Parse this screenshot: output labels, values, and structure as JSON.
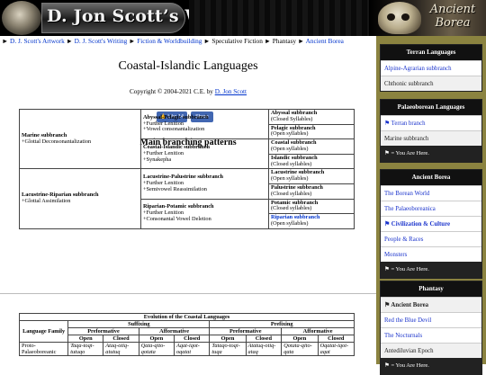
{
  "banner": {
    "title": "D. Jon Scott’s Website",
    "right_line1": "Ancient",
    "right_line2": "Borea"
  },
  "breadcrumb": [
    {
      "text": "D. J. Scott's Artwork",
      "link": true
    },
    {
      "text": "D. J. Scott's Writing",
      "link": true
    },
    {
      "text": "Fiction & Worldbuilding",
      "link": true
    },
    {
      "text": "Speculative Fiction",
      "link": false
    },
    {
      "text": "Phantasy",
      "link": false
    },
    {
      "text": "Ancient Borea",
      "link": true
    }
  ],
  "page": {
    "title": "Coastal-Islandic Languages",
    "copyright_prefix": "Copyright © 2004-2021 C.E. by ",
    "copyright_author": "D. Jon Scott",
    "fb_label": "Like 14",
    "share_label": "Share",
    "section_heading": "Main branching patterns"
  },
  "branching": {
    "marine": {
      "name": "Marine subbranch",
      "desc": "+Glottal Deconsonantalization"
    },
    "lacustrine_riparian": {
      "name": "Lacustrine-Riparian subbranch",
      "desc": "+Glottal Assimilation"
    },
    "abyssal_pelagic": {
      "name": "Abyssal-Pelagic subbranch",
      "d1": "+Further Lenition",
      "d2": "+Vowel consonantalization"
    },
    "coastal_islandic": {
      "name": "Coastal-Islandic subbranch",
      "d1": "+Further Lenition",
      "d2": "+Synakepha"
    },
    "lacustrine_palustrine": {
      "name": "Lacustrine-Palustrine subbranch",
      "d1": "+Further Lenition",
      "d2": "+Semivowel Reassimilation"
    },
    "riparian_potamic": {
      "name": "Riparian-Potamic subbranch",
      "d1": "+Further Lenition",
      "d2": "+Consonantal Vowel Deletion"
    },
    "leaves": [
      {
        "name": "Abyssal subbranch",
        "desc": "(Closed Syllables)"
      },
      {
        "name": "Pelagic subbranch",
        "desc": "(Open syllables)"
      },
      {
        "name": "Coastal subbranch",
        "desc": "(Open syllables)"
      },
      {
        "name": "Islandic subbranch",
        "desc": "(Closed syllables)"
      },
      {
        "name": "Lacustrine subbranch",
        "desc": "(Open syllables)"
      },
      {
        "name": "Palustrine subbranch",
        "desc": "(Closed syllables)"
      },
      {
        "name": "Potamic subbranch",
        "desc": "(Closed syllables)"
      },
      {
        "name": "Riparian subbranch",
        "desc": "(Open syllables)"
      }
    ]
  },
  "evolution": {
    "caption": "Evolution of the Coastal Languages",
    "suffixing": "Suffixing",
    "prefixing": "Prefixing",
    "language_family": "Language Family",
    "preformative": "Preformative",
    "afformative": "Afformative",
    "open": "Open",
    "closed": "Closed",
    "row1": {
      "family": "Proto-Palaeoboreanic",
      "cells": [
        "Taqa-toqi-tutuqo",
        "Ataq-otiq-atutuq",
        "Qata-qito-qotata",
        "Aqat-iqot-oqatat",
        "Tataqo-toqi-tuqa",
        "Atatuq-otiq-ataq",
        "Qotata-qito-qata",
        "Oqatat-iqot-aqat"
      ]
    }
  },
  "sidebar": {
    "terran": {
      "header": "Terran Languages",
      "items": [
        "Alpine-Agrarian subbranch",
        "Chthonic subbranch"
      ]
    },
    "palaeo": {
      "header": "Palaeoborean Languages",
      "items": [
        "⚑ Terran branch",
        "Marine subbranch"
      ],
      "footer": "⚑ = You Are Here."
    },
    "ancient": {
      "header": "Ancient Borea",
      "items": [
        "The Borean World",
        "The Palaeoboreanica",
        "⚑ Civilization & Culture",
        "People & Races",
        "Monsters"
      ],
      "footer": "⚑ = You Are Here."
    },
    "phantasy": {
      "header": "Phantasy",
      "items": [
        "⚑ Ancient Borea",
        "Red the Blue Devil",
        "The Nocturnals",
        "Antediluvian Epoch"
      ],
      "footer": "⚑ = You Are Here."
    }
  }
}
